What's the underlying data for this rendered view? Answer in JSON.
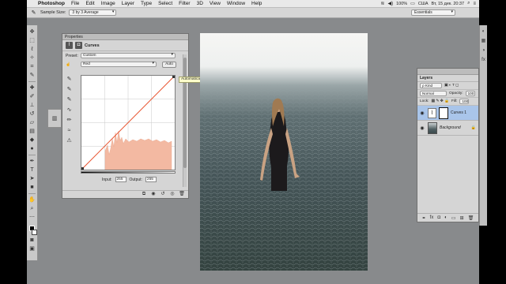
{
  "menubar": {
    "apple": "",
    "app": "Photoshop",
    "items": [
      "File",
      "Edit",
      "Image",
      "Layer",
      "Type",
      "Select",
      "Filter",
      "3D",
      "View",
      "Window",
      "Help"
    ],
    "status": {
      "battery": "100%",
      "input_source": "США",
      "datetime": "Вт, 15 дек.  20:37"
    }
  },
  "options": {
    "sample_label": "Sample Size:",
    "sample_value": "3 by 3 Average",
    "workspace": "Essentials"
  },
  "properties": {
    "panel_title": "Properties",
    "title": "Curves",
    "preset_label": "Preset:",
    "preset_value": "Custom",
    "channel_value": "Red",
    "auto_label": "Auto",
    "tooltip": "Automatically correct curves (use Opt for options)",
    "input_label": "Input:",
    "input_value": "255",
    "output_label": "Output:",
    "output_value": "255"
  },
  "layers": {
    "panel_title": "Layers",
    "kind_label": "ρ Kind",
    "blend_mode": "Normal",
    "opacity_label": "Opacity:",
    "opacity_value": "100",
    "lock_label": "Lock:",
    "fill_label": "Fill:",
    "fill_value": "100",
    "items": [
      {
        "name": "Curves 1",
        "active": true
      },
      {
        "name": "Background",
        "active": false
      }
    ]
  },
  "colors": {
    "histogram": "#f3b9a2",
    "curve": "#e8532f",
    "layer_highlight": "#a9c5ea",
    "tooltip_bg": "#ffffcc"
  }
}
